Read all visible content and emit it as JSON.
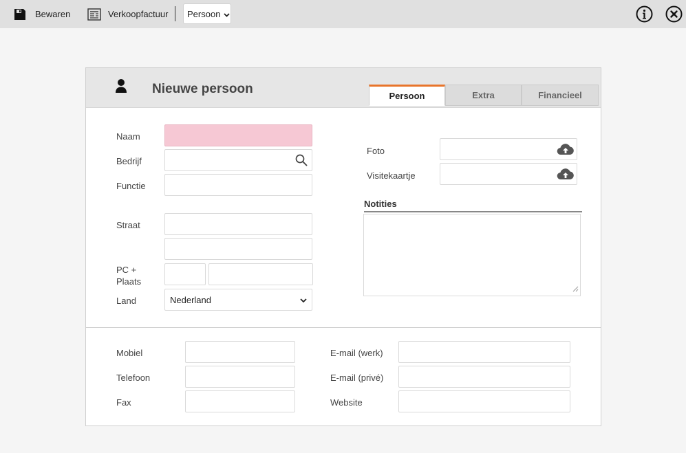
{
  "toolbar": {
    "save_label": "Bewaren",
    "invoice_label": "Verkoopfactuur",
    "type_select_value": "Persoon"
  },
  "form": {
    "title": "Nieuwe persoon",
    "tabs": [
      {
        "label": "Persoon",
        "active": true
      },
      {
        "label": "Extra",
        "active": false
      },
      {
        "label": "Financieel",
        "active": false
      }
    ],
    "labels": {
      "naam": "Naam",
      "bedrijf": "Bedrijf",
      "functie": "Functie",
      "straat": "Straat",
      "pc_plaats_line1": "PC +",
      "pc_plaats_line2": "Plaats",
      "land": "Land",
      "foto": "Foto",
      "visitekaartje": "Visitekaartje",
      "notities": "Notities",
      "mobiel": "Mobiel",
      "telefoon": "Telefoon",
      "fax": "Fax",
      "email_werk": "E-mail (werk)",
      "email_prive": "E-mail (privé)",
      "website": "Website"
    },
    "values": {
      "land": "Nederland"
    }
  },
  "colors": {
    "tab_accent": "#e8742a",
    "required_field": "#f6c8d4"
  },
  "icons": {
    "save": "floppy-disk-icon",
    "invoice": "invoice-icon",
    "info": "info-icon",
    "close": "close-icon",
    "person": "person-icon",
    "search": "search-icon",
    "upload": "cloud-upload-icon"
  }
}
